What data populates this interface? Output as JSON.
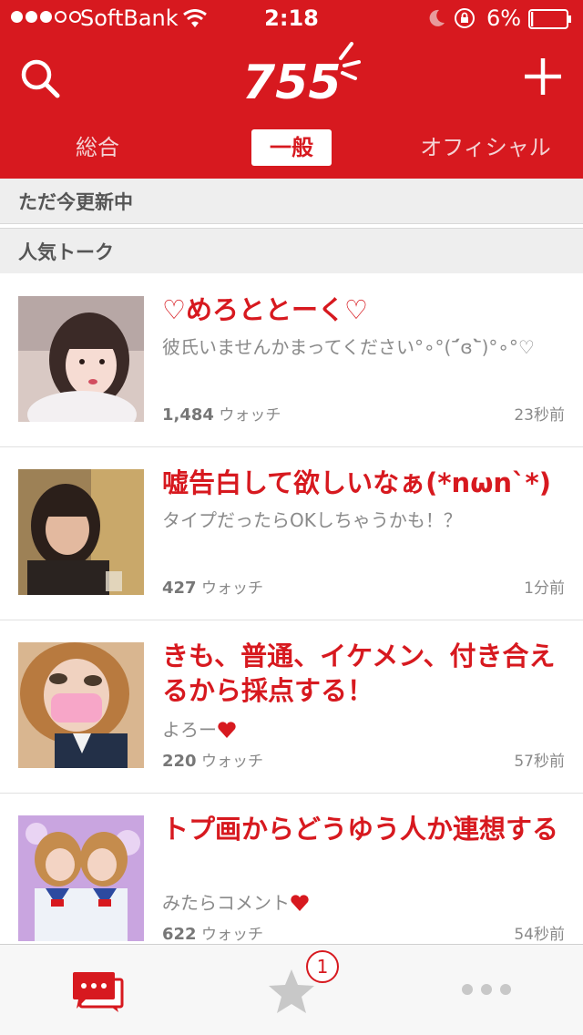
{
  "status_bar": {
    "signal_strength": 3,
    "signal_max": 5,
    "carrier": "SoftBank",
    "time": "2:18",
    "battery_percent": "6%",
    "battery_level": 0.06,
    "icons": [
      "wifi-icon",
      "moon-icon",
      "orientation-lock-icon",
      "battery-icon"
    ]
  },
  "header": {
    "logo": "755",
    "search_icon": "search-icon",
    "add_icon": "plus-icon",
    "color": "#d7191f"
  },
  "tabs": [
    {
      "label": "総合",
      "selected": false
    },
    {
      "label": "一般",
      "selected": true
    },
    {
      "label": "オフィシャル",
      "selected": false
    }
  ],
  "sections": {
    "updating": "ただ今更新中",
    "popular": "人気トーク"
  },
  "talks": [
    {
      "title": "♡めろととーく♡",
      "description": "彼氏いませんかまってください°∘°(ˊ᷄ɞˋ᷅)°∘°♡",
      "watch_count": "1,484",
      "watch_label": "ウォッチ",
      "time_ago": "23秒前"
    },
    {
      "title": "嘘告白して欲しいなぁ(*nωn`*)",
      "description": "タイプだったらOKしちゃうかも！？",
      "watch_count": "427",
      "watch_label": "ウォッチ",
      "time_ago": "1分前"
    },
    {
      "title": "きも、普通、イケメン、付き合えるから採点する！",
      "description": "よろー",
      "watch_count": "220",
      "watch_label": "ウォッチ",
      "time_ago": "57秒前"
    },
    {
      "title": "トプ画からどうゆう人か連想する",
      "description": "みたらコメント",
      "watch_count": "622",
      "watch_label": "ウォッチ",
      "time_ago": "54秒前"
    }
  ],
  "bottom_bar": {
    "talk_icon": "chat-bubbles-icon",
    "star_icon": "star-icon",
    "star_badge": "1",
    "more_icon": "more-dots-icon"
  }
}
